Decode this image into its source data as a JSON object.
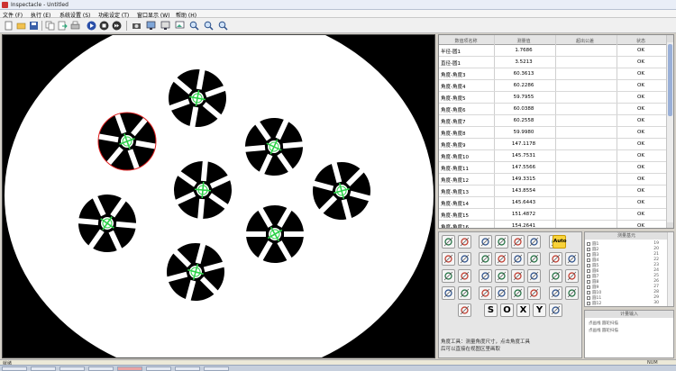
{
  "window": {
    "title": "Inspectacle - Untitled"
  },
  "menu": [
    "文件 (F)",
    "执行 (E)",
    "系统设置 (S)",
    "功能设定 (T)",
    "窗口显示 (W)",
    "帮助 (H)"
  ],
  "toolbar_icons": [
    "new-file-icon",
    "open-folder-icon",
    "save-icon",
    "copy-icon",
    "export-icon",
    "print-icon",
    "play-icon",
    "stop-icon",
    "forward-icon",
    "camera-icon",
    "monitor-icon",
    "display-icon",
    "image-icon",
    "zoom-in-icon",
    "zoom-out-icon",
    "zoom-fit-icon"
  ],
  "table": {
    "headers": [
      "数值项名称",
      "测量值",
      "超出公差",
      "状态"
    ],
    "rows": [
      {
        "name": "半径-圆1",
        "value": "1.7686",
        "tol": "",
        "status": "OK"
      },
      {
        "name": "直径-圆1",
        "value": "3.5213",
        "tol": "",
        "status": "OK"
      },
      {
        "name": "角度-角度3",
        "value": "60.3613",
        "tol": "",
        "status": "OK"
      },
      {
        "name": "角度-角度4",
        "value": "60.2286",
        "tol": "",
        "status": "OK"
      },
      {
        "name": "角度-角度5",
        "value": "59.7955",
        "tol": "",
        "status": "OK"
      },
      {
        "name": "角度-角度6",
        "value": "60.0388",
        "tol": "",
        "status": "OK"
      },
      {
        "name": "角度-角度7",
        "value": "60.2558",
        "tol": "",
        "status": "OK"
      },
      {
        "name": "角度-角度8",
        "value": "59.9980",
        "tol": "",
        "status": "OK"
      },
      {
        "name": "角度-角度9",
        "value": "147.1178",
        "tol": "",
        "status": "OK"
      },
      {
        "name": "角度-角度10",
        "value": "145.7531",
        "tol": "",
        "status": "OK"
      },
      {
        "name": "角度-角度11",
        "value": "147.5566",
        "tol": "",
        "status": "OK"
      },
      {
        "name": "角度-角度12",
        "value": "149.3315",
        "tol": "",
        "status": "OK"
      },
      {
        "name": "角度-角度13",
        "value": "143.8554",
        "tol": "",
        "status": "OK"
      },
      {
        "name": "角度-角度14",
        "value": "145.6443",
        "tol": "",
        "status": "OK"
      },
      {
        "name": "角度-角度15",
        "value": "151.4872",
        "tol": "",
        "status": "OK"
      },
      {
        "name": "角度-角度16",
        "value": "154.2641",
        "tol": "",
        "status": "OK"
      }
    ]
  },
  "tools": {
    "auto_label": "Auto",
    "letters": [
      "S",
      "O",
      "X",
      "Y"
    ],
    "status_message": "角度工具：测量角度尺寸，点击角度工具后可以直接在视图区里画取"
  },
  "side_list": {
    "header": "测量基元",
    "items": [
      {
        "label": "圆1",
        "num": "19"
      },
      {
        "label": "圆2",
        "num": "20"
      },
      {
        "label": "圆3",
        "num": "21"
      },
      {
        "label": "圆4",
        "num": "22"
      },
      {
        "label": "圆5",
        "num": "23"
      },
      {
        "label": "圆6",
        "num": "24"
      },
      {
        "label": "圆7",
        "num": "25"
      },
      {
        "label": "圆8",
        "num": "26"
      },
      {
        "label": "圆9",
        "num": "27"
      },
      {
        "label": "圆10",
        "num": "28"
      },
      {
        "label": "圆11",
        "num": "29"
      },
      {
        "label": "圆12",
        "num": "30"
      }
    ]
  },
  "output_box": {
    "header": "计量输入",
    "lines": [
      "点画线    圆轮扫描",
      "点画线    圆轮扫描"
    ]
  },
  "statusbar": {
    "left": "就绪",
    "right": "NUM"
  },
  "colors": {
    "highlight": "#f8d23a",
    "crosshair": "#2fd14a",
    "selection": "#e02020"
  }
}
